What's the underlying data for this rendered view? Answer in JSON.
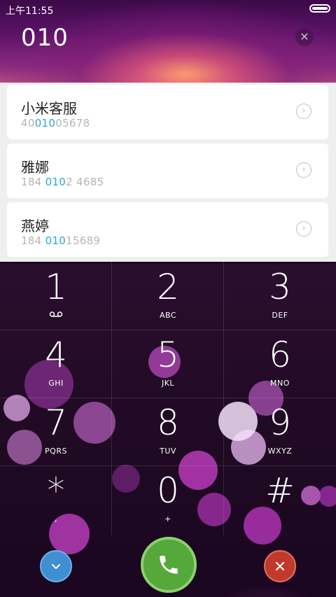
{
  "status_bar": {
    "time": "上午11:55"
  },
  "dial_input": {
    "number": "010",
    "clear_icon": "clear-icon"
  },
  "contacts": [
    {
      "name": "小米客服",
      "num_pre": "40",
      "num_match": "010",
      "num_post": "05678"
    },
    {
      "name": "雅娜",
      "num_pre": "184 ",
      "num_match": "010",
      "num_post": "2 4685"
    },
    {
      "name": "燕婷",
      "num_pre": "184 ",
      "num_match": "010",
      "num_post": "15689"
    }
  ],
  "keypad": {
    "keys": [
      {
        "digit": "1",
        "letters": ""
      },
      {
        "digit": "2",
        "letters": "ABC"
      },
      {
        "digit": "3",
        "letters": "DEF"
      },
      {
        "digit": "4",
        "letters": "GHI"
      },
      {
        "digit": "5",
        "letters": "JKL"
      },
      {
        "digit": "6",
        "letters": "MNO"
      },
      {
        "digit": "7",
        "letters": "PQRS"
      },
      {
        "digit": "8",
        "letters": "TUV"
      },
      {
        "digit": "9",
        "letters": "WXYZ"
      },
      {
        "digit": "*",
        "letters": ","
      },
      {
        "digit": "0",
        "letters": "+"
      },
      {
        "digit": "#",
        "letters": ""
      }
    ]
  },
  "actions": {
    "collapse_icon": "chevron-down-icon",
    "call_icon": "phone-icon",
    "cancel_icon": "close-icon"
  },
  "colors": {
    "highlight": "#2ea4dc",
    "collapse_button": "#3f8fd1",
    "call_button": "#55a83a",
    "cancel_button": "#c1392b"
  }
}
